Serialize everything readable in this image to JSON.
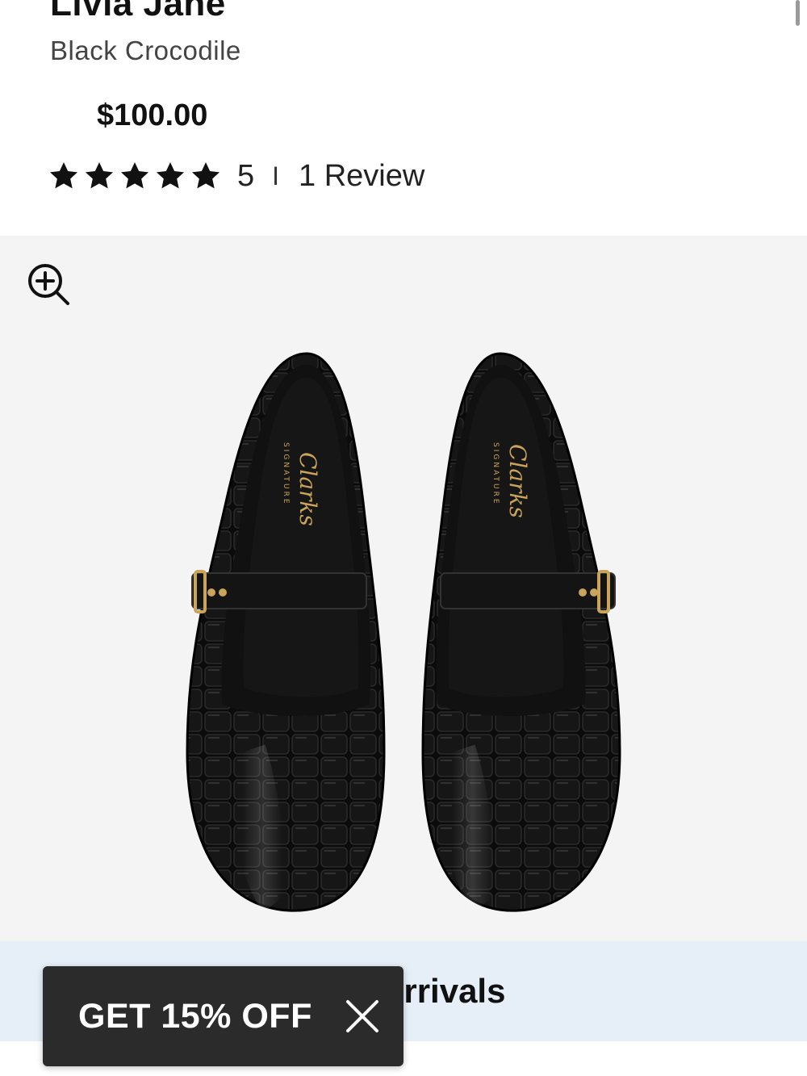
{
  "product": {
    "title": "Livia Jane",
    "color": "Black Crocodile",
    "price": "$100.00"
  },
  "rating": {
    "stars": 5,
    "value": "5",
    "separator": "I",
    "reviews_label": "1 Review"
  },
  "gallery": {
    "zoom_icon": "zoom-in-icon",
    "insole_brand": "Clarks",
    "insole_subbrand": "SIGNATURE"
  },
  "banner": {
    "text": "New Arrivals"
  },
  "promo": {
    "label": "GET 15% OFF",
    "close_icon": "close-icon"
  },
  "colors": {
    "background": "#ffffff",
    "gallery_bg": "#f4f4f4",
    "banner_bg": "#e6eef8",
    "promo_bg": "#2b2b2b"
  }
}
